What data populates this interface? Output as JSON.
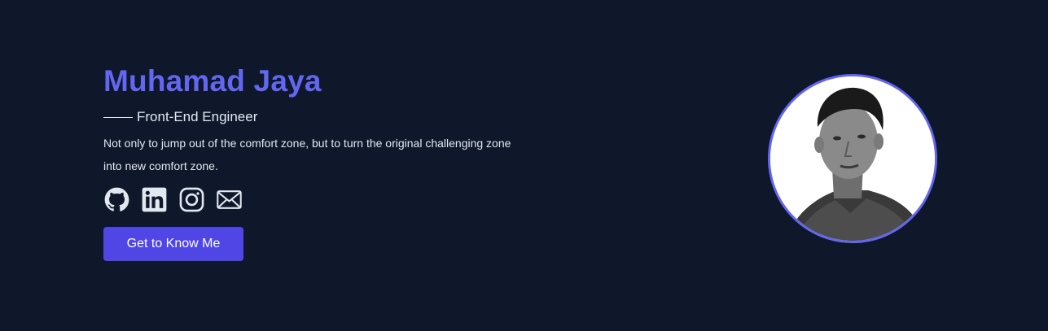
{
  "hero": {
    "name": "Muhamad Jaya",
    "role": "Front-End Engineer",
    "description": "Not only to jump out of the comfort zone, but to turn the original challenging zone into new comfort zone.",
    "cta_label": "Get to Know Me"
  },
  "socials": [
    {
      "icon": "github-icon"
    },
    {
      "icon": "linkedin-icon"
    },
    {
      "icon": "instagram-icon"
    },
    {
      "icon": "mail-icon"
    }
  ],
  "colors": {
    "background": "#0f172a",
    "accent": "#6366f1",
    "button": "#4f46e5",
    "text": "#e2e8f0"
  }
}
